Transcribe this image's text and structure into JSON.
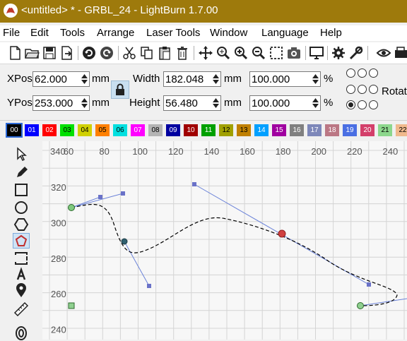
{
  "window": {
    "title": "<untitled> * - GRBL_24 - LightBurn 1.7.00"
  },
  "menu": [
    "File",
    "Edit",
    "Tools",
    "Arrange",
    "Laser Tools",
    "Window",
    "Language",
    "Help"
  ],
  "toolbar_icons": [
    "new-file-icon",
    "open-folder-icon",
    "save-icon",
    "import-icon",
    "undo-icon",
    "redo-icon",
    "cut-icon",
    "copy-icon",
    "paste-icon",
    "delete-icon",
    "move-icon",
    "zoom-to-page-icon",
    "zoom-in-icon",
    "zoom-out-icon",
    "zoom-selection-icon",
    "camera-icon",
    "monitor-icon",
    "settings-icon",
    "tools-icon",
    "preview-icon",
    "machine-icon"
  ],
  "position": {
    "xpos_label": "XPos",
    "xpos_value": "62.000",
    "xpos_unit": "mm",
    "ypos_label": "YPos",
    "ypos_value": "253.000",
    "ypos_unit": "mm",
    "width_label": "Width",
    "width_value": "182.048",
    "width_unit": "mm",
    "height_label": "Height",
    "height_value": "56.480",
    "height_unit": "mm",
    "width_pct": "100.000",
    "height_pct": "100.000",
    "pct_unit": "%",
    "rotate_label": "Rotat"
  },
  "palette": [
    {
      "label": "00",
      "color": "#000000",
      "text": "#ffffff",
      "selected": true
    },
    {
      "label": "01",
      "color": "#0000ff",
      "text": "#ffffff"
    },
    {
      "label": "02",
      "color": "#ff0000",
      "text": "#ffffff"
    },
    {
      "label": "03",
      "color": "#00e000",
      "text": "#000000"
    },
    {
      "label": "04",
      "color": "#d0d000",
      "text": "#000000"
    },
    {
      "label": "05",
      "color": "#ff8000",
      "text": "#000000"
    },
    {
      "label": "06",
      "color": "#00e0e0",
      "text": "#000000"
    },
    {
      "label": "07",
      "color": "#ff00ff",
      "text": "#ffffff"
    },
    {
      "label": "08",
      "color": "#b4b4b4",
      "text": "#000000"
    },
    {
      "label": "09",
      "color": "#0000a0",
      "text": "#ffffff"
    },
    {
      "label": "10",
      "color": "#a00000",
      "text": "#ffffff"
    },
    {
      "label": "11",
      "color": "#00a000",
      "text": "#ffffff"
    },
    {
      "label": "12",
      "color": "#a0a000",
      "text": "#000000"
    },
    {
      "label": "13",
      "color": "#c08000",
      "text": "#000000"
    },
    {
      "label": "14",
      "color": "#00a0ff",
      "text": "#ffffff"
    },
    {
      "label": "15",
      "color": "#a000a0",
      "text": "#ffffff"
    },
    {
      "label": "16",
      "color": "#808080",
      "text": "#ffffff"
    },
    {
      "label": "17",
      "color": "#7d87b9",
      "text": "#ffffff"
    },
    {
      "label": "18",
      "color": "#bb7784",
      "text": "#ffffff"
    },
    {
      "label": "19",
      "color": "#4a6fe3",
      "text": "#ffffff"
    },
    {
      "label": "20",
      "color": "#d33f6a",
      "text": "#ffffff"
    },
    {
      "label": "21",
      "color": "#8cd78c",
      "text": "#000000"
    },
    {
      "label": "22",
      "color": "#f0b98d",
      "text": "#000000"
    }
  ],
  "tools": [
    "select-tool-icon",
    "draw-lines-icon",
    "rectangle-icon",
    "ellipse-icon",
    "polygon-icon",
    "edit-nodes-icon",
    "text-tool-icon",
    "position-laser-icon",
    "measure-icon",
    "offset-icon"
  ],
  "ruler": {
    "x_ticks": [
      "60",
      "80",
      "100",
      "120",
      "140",
      "160",
      "180",
      "200",
      "220",
      "240"
    ],
    "x_overlap": "340",
    "y_ticks": [
      "320",
      "300",
      "280",
      "260",
      "240"
    ]
  },
  "colors": {
    "titlebar": "#9e7a0c",
    "curve": "#000000",
    "handles": "#5a6fd0",
    "start_node": "#7fc97f",
    "mid_node": "#2f5f6f",
    "selected_node": "#d04040"
  }
}
